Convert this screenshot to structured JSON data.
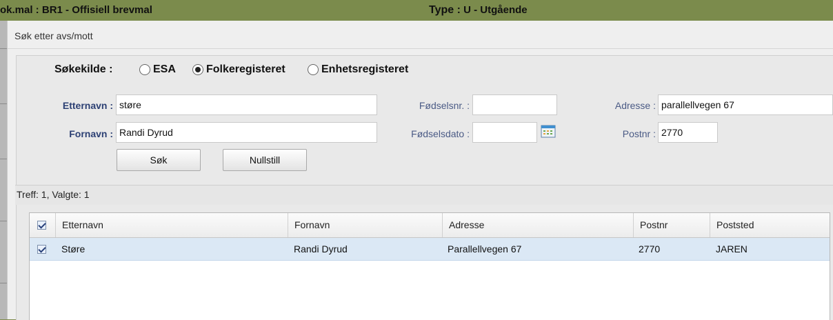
{
  "header": {
    "dokmal_label": "ok.mal :",
    "dokmal_value": "BR1 - Offisiell brevmal",
    "type_label": "Type :",
    "type_value": "U - Utgående"
  },
  "dialog": {
    "title": "Søk etter avs/mott"
  },
  "search_source": {
    "label": "Søkekilde :",
    "options": [
      {
        "label": "ESA",
        "selected": false
      },
      {
        "label": "Folkeregisteret",
        "selected": true
      },
      {
        "label": "Enhetsregisteret",
        "selected": false
      }
    ]
  },
  "form": {
    "etternavn_label": "Etternavn :",
    "etternavn_value": "støre",
    "fornavn_label": "Fornavn :",
    "fornavn_value": "Randi Dyrud",
    "fodselsnr_label": "Fødselsnr. :",
    "fodselsnr_value": "",
    "fodselsdato_label": "Fødselsdato :",
    "fodselsdato_value": "",
    "adresse_label": "Adresse :",
    "adresse_value": "parallellvegen 67",
    "postnr_label": "Postnr :",
    "postnr_value": "2770",
    "calendar_icon": "calendar-icon"
  },
  "buttons": {
    "search": "Søk",
    "reset": "Nullstill"
  },
  "results": {
    "summary": "Treff: 1, Valgte: 1",
    "columns": [
      "Etternavn",
      "Fornavn",
      "Adresse",
      "Postnr",
      "Poststed"
    ],
    "header_checked": true,
    "rows": [
      {
        "checked": true,
        "etternavn": "Støre",
        "fornavn": "Randi Dyrud",
        "adresse": "Parallellvegen 67",
        "postnr": "2770",
        "poststed": "JAREN"
      }
    ]
  },
  "colors": {
    "topbar": "#7b8b4c",
    "selected_row": "#dbe8f5",
    "label_blue": "#2b3f73"
  }
}
